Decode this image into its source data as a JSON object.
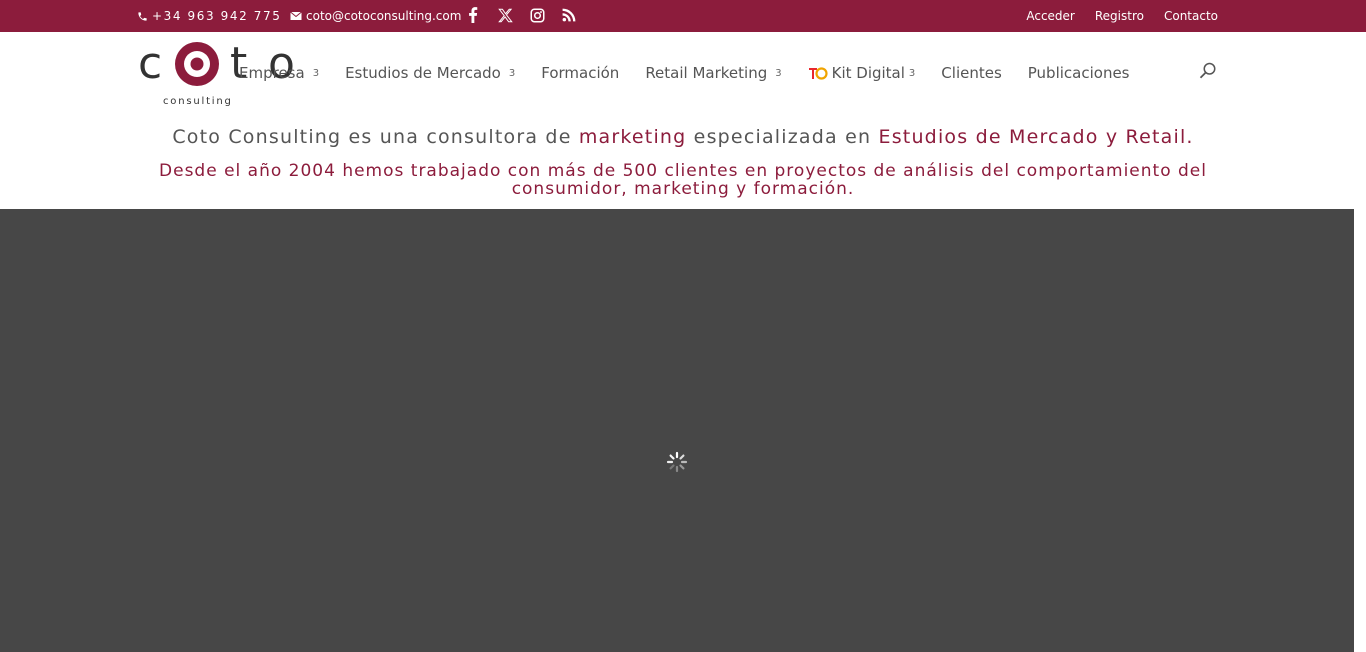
{
  "topbar": {
    "phone": "+34 963 942 775",
    "email": "coto@cotoconsulting.com",
    "social_icons": [
      "facebook-icon",
      "x-icon",
      "instagram-icon",
      "rss-icon"
    ],
    "links": {
      "login": "Acceder",
      "register": "Registro",
      "contact": "Contacto"
    },
    "background": "#8c1c3c"
  },
  "logo": {
    "word": "c  t o",
    "sub": "consulting",
    "accent": "#8c1c3c"
  },
  "nav": {
    "items": [
      {
        "label": "Empresa",
        "chevron": "3"
      },
      {
        "label": "Estudios de Mercado",
        "chevron": "3"
      },
      {
        "label": "Formación",
        "chevron": ""
      },
      {
        "label": "Retail Marketing",
        "chevron": "3"
      },
      {
        "label": "Kit Digital",
        "chevron": "3"
      },
      {
        "label": "Clientes",
        "chevron": ""
      },
      {
        "label": "Publicaciones",
        "chevron": ""
      }
    ]
  },
  "tagline": {
    "part1": "Coto Consulting es una consultora de ",
    "part2": "marketing",
    "part3": " especializada en ",
    "part4": "Estudios de Mercado y Retail."
  },
  "subline": "Desde el año 2004 hemos trabajado con más de 500 clientes en proyectos de análisis del comportamiento del consumidor, marketing y formación.",
  "colors": {
    "brand": "#8c1c3c",
    "hero": "#474747",
    "text": "#555555"
  }
}
